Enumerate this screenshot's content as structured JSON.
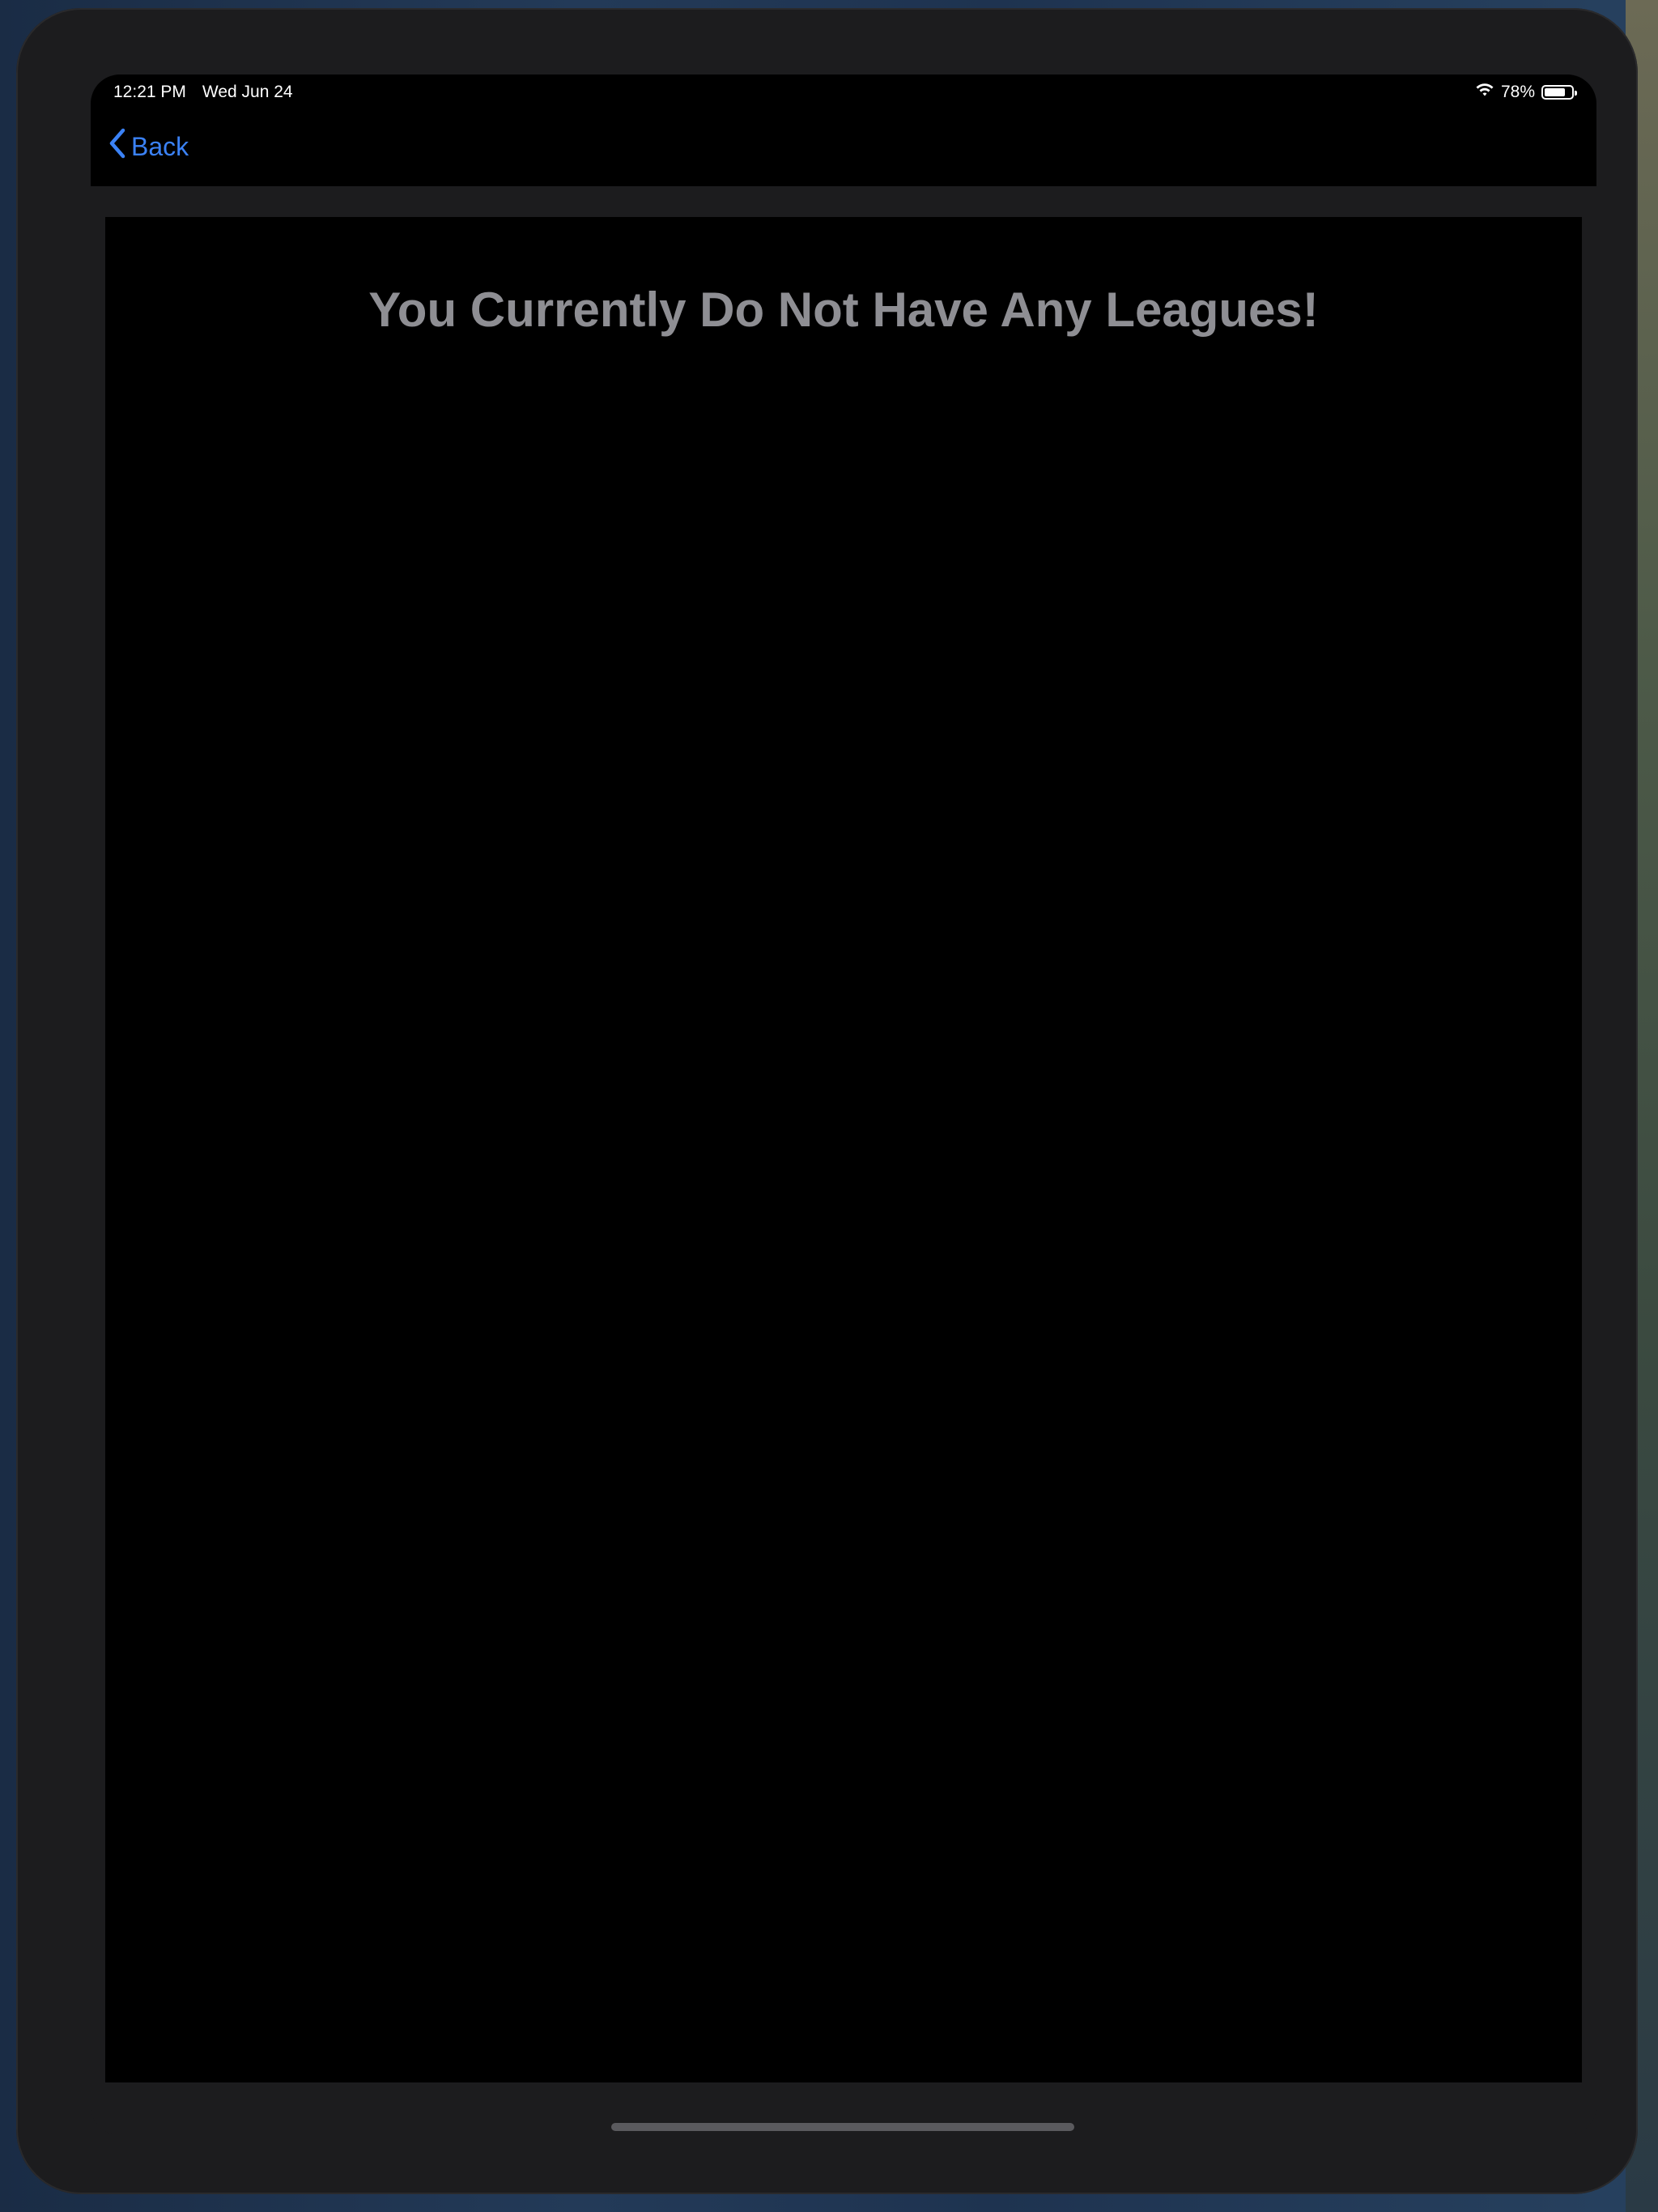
{
  "status_bar": {
    "time": "12:21 PM",
    "date": "Wed Jun 24",
    "battery_text": "78%",
    "battery_level": 0.78
  },
  "nav": {
    "back_label": "Back",
    "accent_color": "#3b82f6"
  },
  "content": {
    "empty_message": "You Currently Do Not Have Any Leagues!"
  },
  "icons": {
    "back": "chevron-left-icon",
    "wifi": "wifi-icon",
    "battery": "battery-icon"
  }
}
